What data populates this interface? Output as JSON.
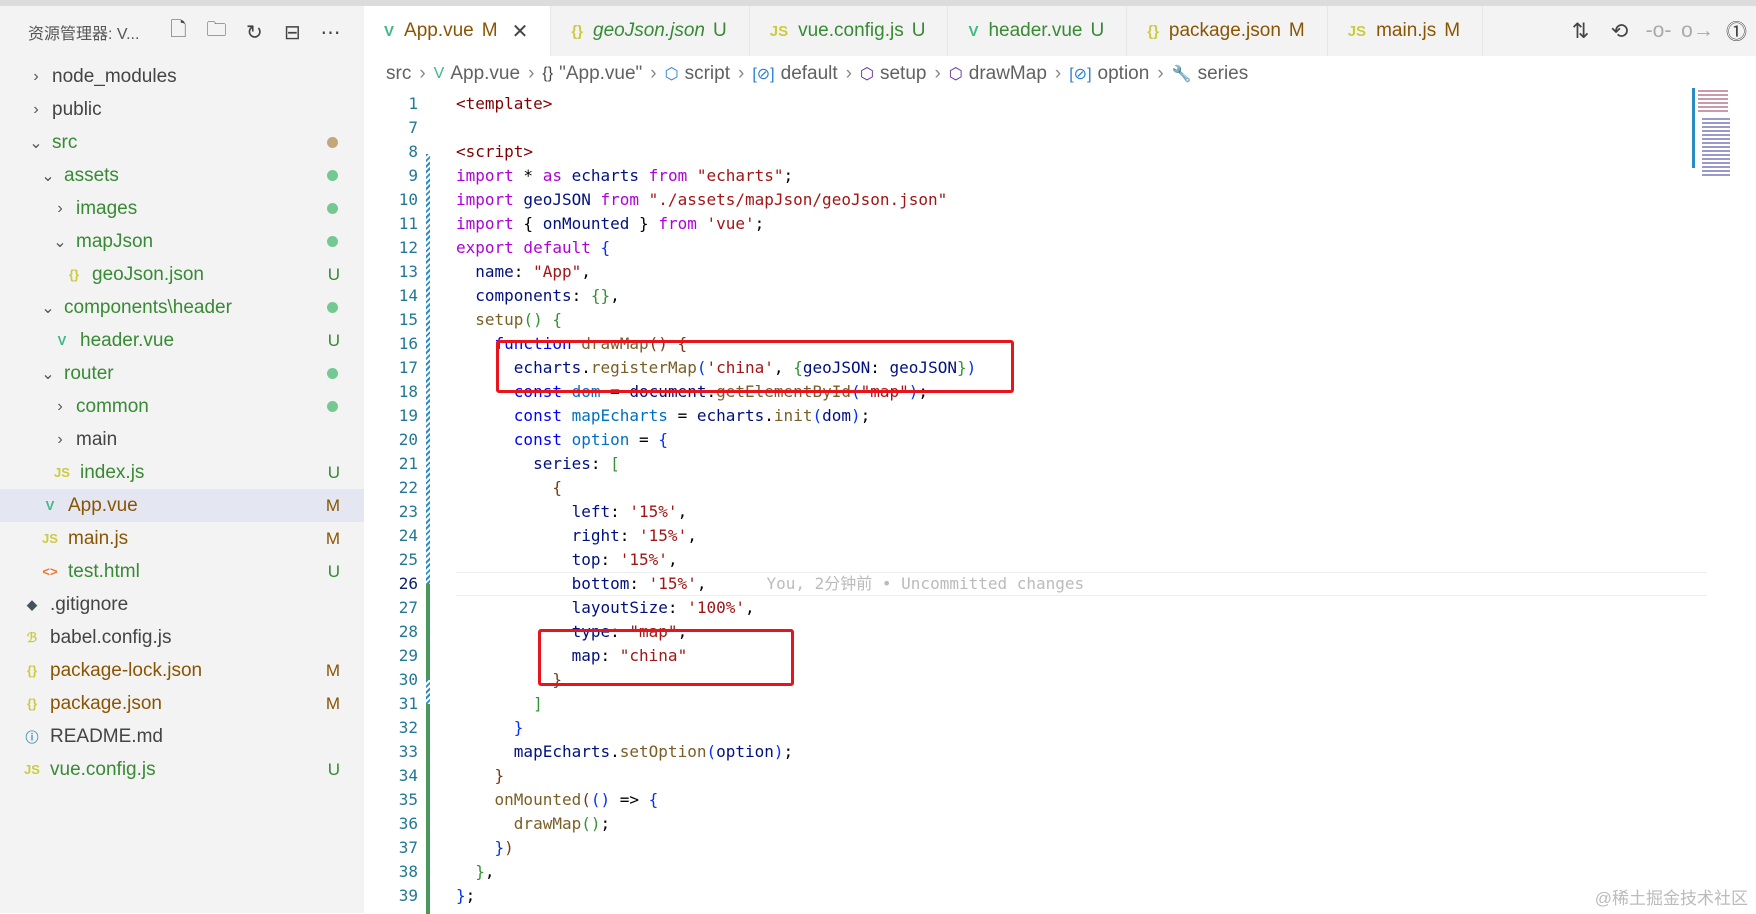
{
  "explorer": {
    "title": "资源管理器: V...",
    "actions": [
      "new-file-icon",
      "new-folder-icon",
      "refresh-icon",
      "collapse-icon",
      "more-icon"
    ],
    "tree": [
      {
        "label": "node_modules",
        "depth": 0,
        "type": "folder",
        "open": false,
        "color": "#444"
      },
      {
        "label": "public",
        "depth": 0,
        "type": "folder",
        "open": false,
        "color": "#444"
      },
      {
        "label": "src",
        "depth": 0,
        "type": "folder",
        "open": true,
        "color": "#388a34",
        "dot": "#c5a57a"
      },
      {
        "label": "assets",
        "depth": 1,
        "type": "folder",
        "open": true,
        "color": "#388a34",
        "dot": "#73c991"
      },
      {
        "label": "images",
        "depth": 2,
        "type": "folder",
        "open": false,
        "color": "#388a34",
        "dot": "#73c991"
      },
      {
        "label": "mapJson",
        "depth": 2,
        "type": "folder",
        "open": true,
        "color": "#388a34",
        "dot": "#73c991"
      },
      {
        "label": "geoJson.json",
        "depth": 2,
        "type": "json",
        "color": "#388a34",
        "status": "U"
      },
      {
        "label": "components\\header",
        "depth": 1,
        "type": "folder",
        "open": true,
        "color": "#388a34",
        "dot": "#73c991"
      },
      {
        "label": "header.vue",
        "depth": 1,
        "type": "vue",
        "color": "#388a34",
        "status": "U"
      },
      {
        "label": "router",
        "depth": 1,
        "type": "folder",
        "open": true,
        "color": "#388a34",
        "dot": "#73c991"
      },
      {
        "label": "common",
        "depth": 2,
        "type": "folder",
        "open": false,
        "color": "#388a34",
        "dot": "#73c991"
      },
      {
        "label": "main",
        "depth": 2,
        "type": "folder",
        "open": false,
        "color": "#444"
      },
      {
        "label": "index.js",
        "depth": 1,
        "type": "js",
        "color": "#388a34",
        "status": "U"
      },
      {
        "label": "App.vue",
        "depth": 0,
        "type": "vue",
        "color": "#895503",
        "status": "M",
        "selected": true
      },
      {
        "label": "main.js",
        "depth": 0,
        "type": "js",
        "color": "#895503",
        "status": "M"
      },
      {
        "label": "test.html",
        "depth": 0,
        "type": "html",
        "color": "#388a34",
        "status": "U"
      },
      {
        "label": ".gitignore",
        "depth": -1,
        "type": "git",
        "color": "#444"
      },
      {
        "label": "babel.config.js",
        "depth": -1,
        "type": "babel",
        "color": "#444"
      },
      {
        "label": "package-lock.json",
        "depth": -1,
        "type": "json",
        "color": "#895503",
        "status": "M"
      },
      {
        "label": "package.json",
        "depth": -1,
        "type": "json",
        "color": "#895503",
        "status": "M"
      },
      {
        "label": "README.md",
        "depth": -1,
        "type": "info",
        "color": "#444"
      },
      {
        "label": "vue.config.js",
        "depth": -1,
        "type": "js",
        "color": "#388a34",
        "status": "U"
      }
    ]
  },
  "tabs": [
    {
      "label": "App.vue",
      "status": "M",
      "type": "vue",
      "color": "#895503",
      "active": true,
      "italic": false
    },
    {
      "label": "geoJson.json",
      "status": "U",
      "type": "json",
      "color": "#388a34",
      "italic": true
    },
    {
      "label": "vue.config.js",
      "status": "U",
      "type": "js",
      "color": "#388a34",
      "italic": false
    },
    {
      "label": "header.vue",
      "status": "U",
      "type": "vue",
      "color": "#388a34",
      "italic": false
    },
    {
      "label": "package.json",
      "status": "M",
      "type": "json",
      "color": "#895503",
      "italic": false
    },
    {
      "label": "main.js",
      "status": "M",
      "type": "js",
      "color": "#895503",
      "italic": false
    }
  ],
  "tab_actions": [
    "compare-changes-icon",
    "open-changes-icon",
    "previous-change-icon",
    "next-change-icon",
    "git-graph-icon"
  ],
  "breadcrumb": [
    {
      "label": "src",
      "icon": ""
    },
    {
      "label": "App.vue",
      "icon": "vue"
    },
    {
      "label": "\"App.vue\"",
      "icon": "braces"
    },
    {
      "label": "script",
      "icon": "cube"
    },
    {
      "label": "default",
      "icon": "var"
    },
    {
      "label": "setup",
      "icon": "cube-purple"
    },
    {
      "label": "drawMap",
      "icon": "cube-purple"
    },
    {
      "label": "option",
      "icon": "var"
    },
    {
      "label": "series",
      "icon": "wrench"
    }
  ],
  "editor": {
    "current_line": 26,
    "blame": "You, 2分钟前 • Uncommitted changes",
    "lines": [
      {
        "n": 1,
        "t": [
          [
            "tag",
            "<template>"
          ]
        ]
      },
      {
        "n": 7,
        "t": []
      },
      {
        "n": 8,
        "t": [
          [
            "tag",
            "<script>"
          ]
        ]
      },
      {
        "n": 9,
        "t": [
          [
            "kw",
            "import"
          ],
          [
            "pl",
            " * "
          ],
          [
            "kw",
            "as"
          ],
          [
            "var",
            " echarts "
          ],
          [
            "kw",
            "from"
          ],
          [
            "str",
            " \"echarts\""
          ],
          [
            "pl",
            ";"
          ]
        ]
      },
      {
        "n": 10,
        "t": [
          [
            "kw",
            "import"
          ],
          [
            "var",
            " geoJSON "
          ],
          [
            "kw",
            "from"
          ],
          [
            "str",
            " \"./assets/mapJson/geoJson.json\""
          ]
        ]
      },
      {
        "n": 11,
        "t": [
          [
            "kw",
            "import"
          ],
          [
            "pl",
            " { "
          ],
          [
            "var",
            "onMounted"
          ],
          [
            "pl",
            " } "
          ],
          [
            "kw",
            "from"
          ],
          [
            "str",
            " 'vue'"
          ],
          [
            "pl",
            ";"
          ]
        ]
      },
      {
        "n": 12,
        "t": [
          [
            "kw",
            "export default"
          ],
          [
            "br1",
            " {"
          ]
        ]
      },
      {
        "n": 13,
        "t": [
          [
            "pl",
            "  "
          ],
          [
            "var",
            "name"
          ],
          [
            "pl",
            ": "
          ],
          [
            "str",
            "\"App\""
          ],
          [
            "pl",
            ","
          ]
        ]
      },
      {
        "n": 14,
        "t": [
          [
            "pl",
            "  "
          ],
          [
            "var",
            "components"
          ],
          [
            "pl",
            ": "
          ],
          [
            "br2",
            "{}"
          ],
          [
            "pl",
            ","
          ]
        ]
      },
      {
        "n": 15,
        "t": [
          [
            "pl",
            "  "
          ],
          [
            "fn",
            "setup"
          ],
          [
            "br2",
            "()"
          ],
          [
            "br2",
            " {"
          ]
        ]
      },
      {
        "n": 16,
        "t": [
          [
            "pl",
            "    "
          ],
          [
            "k2",
            "function"
          ],
          [
            "fn",
            " drawMap"
          ],
          [
            "br3",
            "()"
          ],
          [
            "br3",
            " {"
          ]
        ]
      },
      {
        "n": 17,
        "t": [
          [
            "pl",
            "      "
          ],
          [
            "var",
            "echarts"
          ],
          [
            "pl",
            "."
          ],
          [
            "fn",
            "registerMap"
          ],
          [
            "br1",
            "("
          ],
          [
            "str",
            "'china'"
          ],
          [
            "pl",
            ", "
          ],
          [
            "br2",
            "{"
          ],
          [
            "var",
            "geoJSON"
          ],
          [
            "pl",
            ": "
          ],
          [
            "var",
            "geoJSON"
          ],
          [
            "br2",
            "}"
          ],
          [
            "br1",
            ")"
          ]
        ]
      },
      {
        "n": 18,
        "t": [
          [
            "pl",
            "      "
          ],
          [
            "k2",
            "const"
          ],
          [
            "vr",
            " dom"
          ],
          [
            "pl",
            " = "
          ],
          [
            "var",
            "document"
          ],
          [
            "pl",
            "."
          ],
          [
            "fn",
            "getElementById"
          ],
          [
            "br1",
            "("
          ],
          [
            "str",
            "\"map\""
          ],
          [
            "br1",
            ")"
          ],
          [
            "pl",
            ";"
          ]
        ]
      },
      {
        "n": 19,
        "t": [
          [
            "pl",
            "      "
          ],
          [
            "k2",
            "const"
          ],
          [
            "vr",
            " mapEcharts"
          ],
          [
            "pl",
            " = "
          ],
          [
            "var",
            "echarts"
          ],
          [
            "pl",
            "."
          ],
          [
            "fn",
            "init"
          ],
          [
            "br1",
            "("
          ],
          [
            "var",
            "dom"
          ],
          [
            "br1",
            ")"
          ],
          [
            "pl",
            ";"
          ]
        ]
      },
      {
        "n": 20,
        "t": [
          [
            "pl",
            "      "
          ],
          [
            "k2",
            "const"
          ],
          [
            "vr",
            " option"
          ],
          [
            "pl",
            " = "
          ],
          [
            "br1",
            "{"
          ]
        ]
      },
      {
        "n": 21,
        "t": [
          [
            "pl",
            "        "
          ],
          [
            "var",
            "series"
          ],
          [
            "pl",
            ": "
          ],
          [
            "br2",
            "["
          ]
        ]
      },
      {
        "n": 22,
        "t": [
          [
            "pl",
            "          "
          ],
          [
            "br3",
            "{"
          ]
        ]
      },
      {
        "n": 23,
        "t": [
          [
            "pl",
            "            "
          ],
          [
            "var",
            "left"
          ],
          [
            "pl",
            ": "
          ],
          [
            "str",
            "'15%'"
          ],
          [
            "pl",
            ","
          ]
        ]
      },
      {
        "n": 24,
        "t": [
          [
            "pl",
            "            "
          ],
          [
            "var",
            "right"
          ],
          [
            "pl",
            ": "
          ],
          [
            "str",
            "'15%'"
          ],
          [
            "pl",
            ","
          ]
        ]
      },
      {
        "n": 25,
        "t": [
          [
            "pl",
            "            "
          ],
          [
            "var",
            "top"
          ],
          [
            "pl",
            ": "
          ],
          [
            "str",
            "'15%'"
          ],
          [
            "pl",
            ","
          ]
        ]
      },
      {
        "n": 26,
        "t": [
          [
            "pl",
            "            "
          ],
          [
            "var",
            "bottom"
          ],
          [
            "pl",
            ": "
          ],
          [
            "str",
            "'15%'"
          ],
          [
            "pl",
            ","
          ]
        ]
      },
      {
        "n": 27,
        "t": [
          [
            "pl",
            "            "
          ],
          [
            "var",
            "layoutSize"
          ],
          [
            "pl",
            ": "
          ],
          [
            "str",
            "'100%'"
          ],
          [
            "pl",
            ","
          ]
        ]
      },
      {
        "n": 28,
        "t": [
          [
            "pl",
            "            "
          ],
          [
            "var",
            "type"
          ],
          [
            "pl",
            ": "
          ],
          [
            "str",
            "\"map\""
          ],
          [
            "pl",
            ","
          ]
        ]
      },
      {
        "n": 29,
        "t": [
          [
            "pl",
            "            "
          ],
          [
            "var",
            "map"
          ],
          [
            "pl",
            ": "
          ],
          [
            "str",
            "\"china\""
          ]
        ]
      },
      {
        "n": 30,
        "t": [
          [
            "pl",
            "          "
          ],
          [
            "br3",
            "}"
          ]
        ]
      },
      {
        "n": 31,
        "t": [
          [
            "pl",
            "        "
          ],
          [
            "br2",
            "]"
          ]
        ]
      },
      {
        "n": 32,
        "t": [
          [
            "pl",
            "      "
          ],
          [
            "br1",
            "}"
          ]
        ]
      },
      {
        "n": 33,
        "t": [
          [
            "pl",
            "      "
          ],
          [
            "var",
            "mapEcharts"
          ],
          [
            "pl",
            "."
          ],
          [
            "fn",
            "setOption"
          ],
          [
            "br1",
            "("
          ],
          [
            "var",
            "option"
          ],
          [
            "br1",
            ")"
          ],
          [
            "pl",
            ";"
          ]
        ]
      },
      {
        "n": 34,
        "t": [
          [
            "pl",
            "    "
          ],
          [
            "br3",
            "}"
          ]
        ]
      },
      {
        "n": 35,
        "t": [
          [
            "pl",
            "    "
          ],
          [
            "fn",
            "onMounted"
          ],
          [
            "br3",
            "("
          ],
          [
            "br1",
            "()"
          ],
          [
            "pl",
            " => "
          ],
          [
            "br1",
            "{"
          ]
        ]
      },
      {
        "n": 36,
        "t": [
          [
            "pl",
            "      "
          ],
          [
            "fn",
            "drawMap"
          ],
          [
            "br2",
            "()"
          ],
          [
            "pl",
            ";"
          ]
        ]
      },
      {
        "n": 37,
        "t": [
          [
            "pl",
            "    "
          ],
          [
            "br1",
            "}"
          ],
          [
            "br3",
            ")"
          ]
        ]
      },
      {
        "n": 38,
        "t": [
          [
            "pl",
            "  "
          ],
          [
            "br2",
            "}"
          ],
          [
            "pl",
            ","
          ]
        ]
      },
      {
        "n": 39,
        "t": [
          [
            "br1",
            "}"
          ],
          [
            "pl",
            ";"
          ]
        ]
      }
    ]
  },
  "watermark": "@稀土掘金技术社区"
}
